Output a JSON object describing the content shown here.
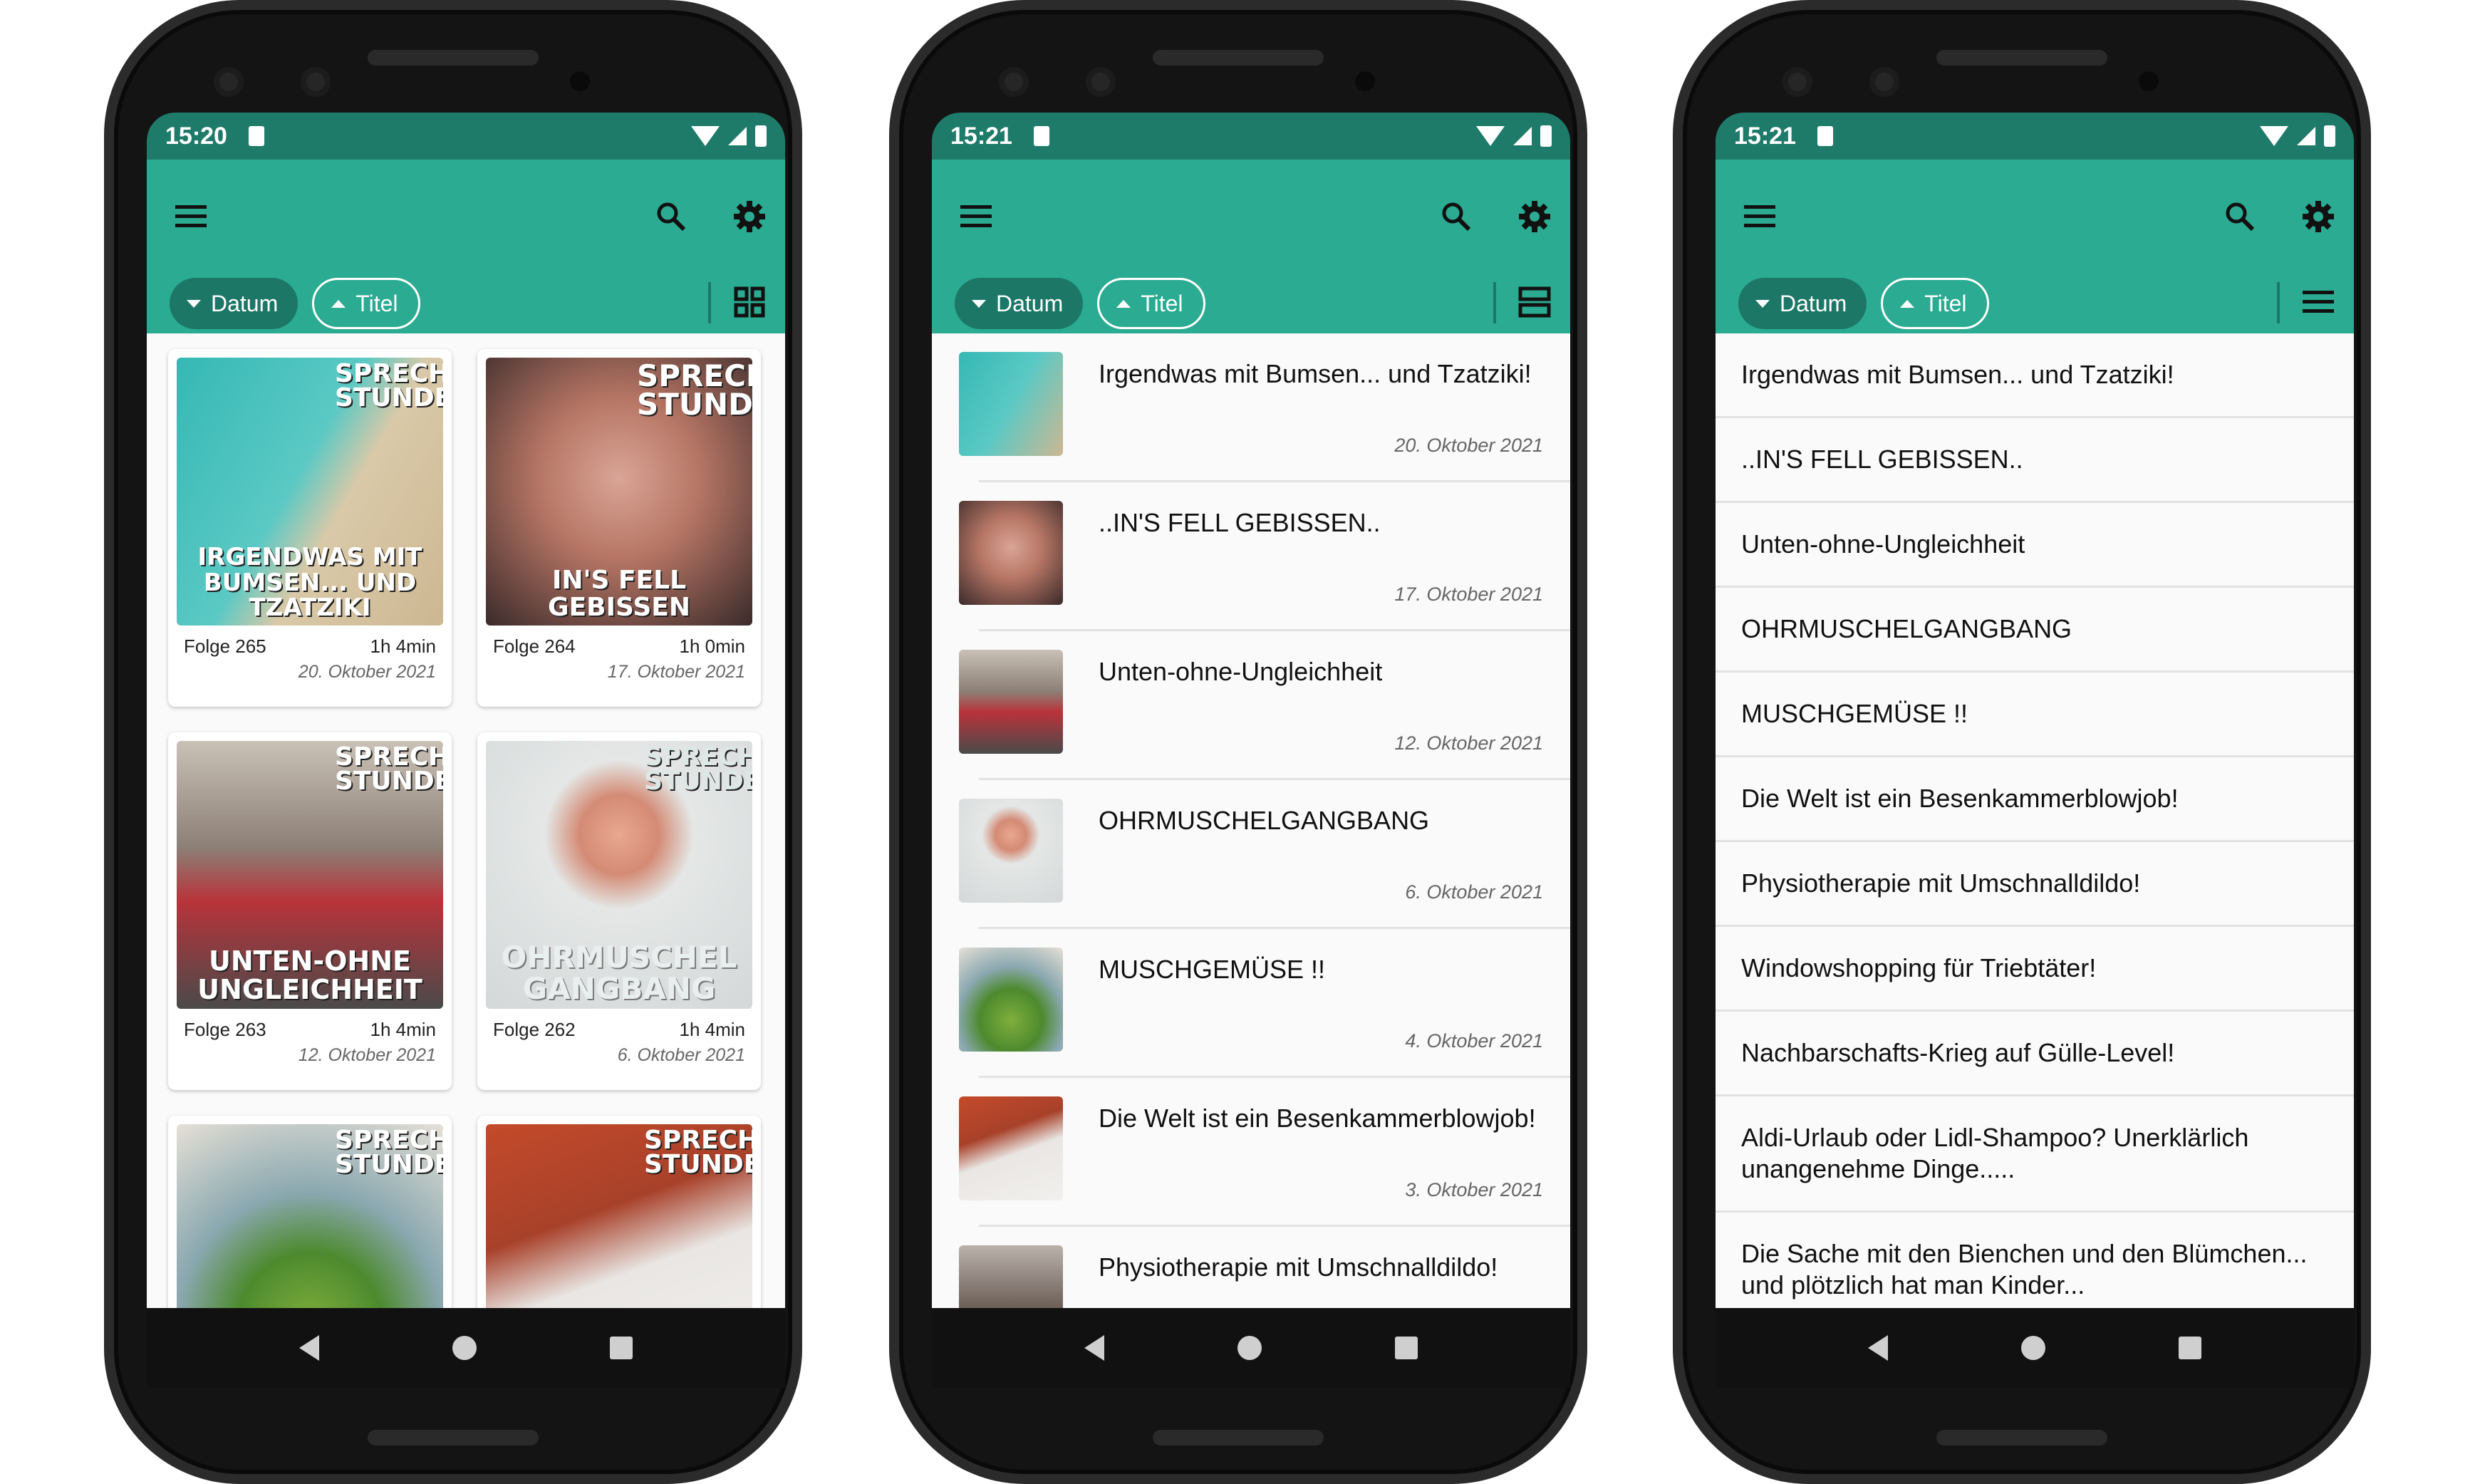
{
  "phones": [
    {
      "status": {
        "time": "15:20"
      },
      "chips": {
        "date": "Datum",
        "title": "Titel"
      },
      "view": "grid",
      "episodes": [
        {
          "episode": "Folge 265",
          "duration": "1h 4min",
          "date": "20. Oktober 2021",
          "badge": "SPRECH STUNDE",
          "caption": "IRGENDWAS MIT BUMSEN... UND TZATZIKI"
        },
        {
          "episode": "Folge 264",
          "duration": "1h 0min",
          "date": "17. Oktober 2021",
          "badge": "SPRECH STUNDE",
          "caption": "IN'S FELL GEBISSEN"
        },
        {
          "episode": "Folge 263",
          "duration": "1h 4min",
          "date": "12. Oktober 2021",
          "badge": "SPRECH STUNDE",
          "caption": "UNTEN-OHNE UNGLEICHHEIT"
        },
        {
          "episode": "Folge 262",
          "duration": "1h 4min",
          "date": "6. Oktober 2021",
          "badge": "SPRECH STUNDE",
          "caption": "OHRMUSCHEL GANGBANG"
        },
        {
          "badge": "SPRECH STUNDE"
        },
        {
          "badge": "SPRECH STUNDE"
        }
      ]
    },
    {
      "status": {
        "time": "15:21"
      },
      "chips": {
        "date": "Datum",
        "title": "Titel"
      },
      "view": "list",
      "episodes": [
        {
          "title": "Irgendwas mit Bumsen... und Tzatziki!",
          "date": "20. Oktober 2021"
        },
        {
          "title": "..IN'S FELL GEBISSEN..",
          "date": "17. Oktober 2021"
        },
        {
          "title": "Unten-ohne-Ungleichheit",
          "date": "12. Oktober 2021"
        },
        {
          "title": "OHRMUSCHELGANGBANG",
          "date": "6. Oktober 2021"
        },
        {
          "title": "MUSCHGEMÜSE !!",
          "date": "4. Oktober 2021"
        },
        {
          "title": "Die Welt ist ein Besenkammerblowjob!",
          "date": "3. Oktober 2021"
        },
        {
          "title": "Physiotherapie mit Umschnalldildo!",
          "date": ""
        }
      ]
    },
    {
      "status": {
        "time": "15:21"
      },
      "chips": {
        "date": "Datum",
        "title": "Titel"
      },
      "view": "compact",
      "episodes": [
        {
          "title": "Irgendwas mit Bumsen... und Tzatziki!"
        },
        {
          "title": "..IN'S FELL GEBISSEN.."
        },
        {
          "title": "Unten-ohne-Ungleichheit"
        },
        {
          "title": "OHRMUSCHELGANGBANG"
        },
        {
          "title": "MUSCHGEMÜSE !!"
        },
        {
          "title": "Die Welt ist ein Besenkammerblowjob!"
        },
        {
          "title": "Physiotherapie mit Umschnalldildo!"
        },
        {
          "title": "Windowshopping für Triebtäter!"
        },
        {
          "title": "Nachbarschafts-Krieg auf Gülle-Level!"
        },
        {
          "title": "Aldi-Urlaub oder Lidl-Shampoo? Unerklärlich unangenehme Dinge....."
        },
        {
          "title": "Die Sache mit den Bienchen und den Blümchen... und plötzlich hat man Kinder..."
        }
      ]
    }
  ],
  "colors": {
    "primary": "#2bab91",
    "primary_dark": "#1f7b69",
    "chip": "#1d7767"
  },
  "icons": [
    "menu-icon",
    "search-icon",
    "gear-icon",
    "grid-view-icon",
    "list-view-icon",
    "compact-list-icon",
    "back-icon",
    "home-icon",
    "recents-icon"
  ]
}
